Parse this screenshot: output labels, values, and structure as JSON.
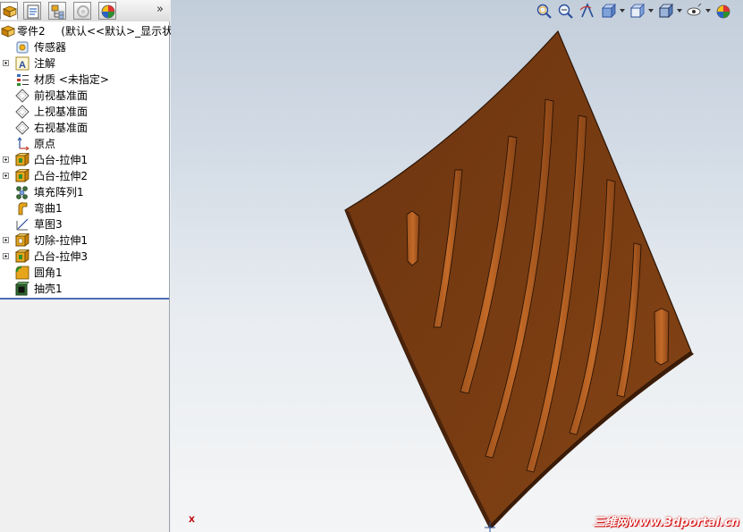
{
  "panel": {
    "tabs": [
      {
        "name": "featuremanager-tab",
        "icon": "feature-tree-icon",
        "active": true
      },
      {
        "name": "propertymanager-tab",
        "icon": "property-manager-icon",
        "active": false
      },
      {
        "name": "configurationmanager-tab",
        "icon": "configuration-manager-icon",
        "active": false
      },
      {
        "name": "dimxpert-tab",
        "icon": "dimxpert-icon",
        "active": false
      },
      {
        "name": "display-manager-tab",
        "icon": "display-manager-icon",
        "active": false
      }
    ],
    "expand_glyph": "»"
  },
  "tree": {
    "root": {
      "label": "零件2",
      "config": "(默认<<默认>_显示状态",
      "icon": "part-icon"
    },
    "items": [
      {
        "label": "传感器",
        "icon": "sensor-icon",
        "expandable": false
      },
      {
        "label": "注解",
        "icon": "annotation-icon",
        "expandable": true
      },
      {
        "label": "材质 <未指定>",
        "icon": "material-icon",
        "expandable": false
      },
      {
        "label": "前视基准面",
        "icon": "plane-icon",
        "expandable": false
      },
      {
        "label": "上视基准面",
        "icon": "plane-icon",
        "expandable": false
      },
      {
        "label": "右视基准面",
        "icon": "plane-icon",
        "expandable": false
      },
      {
        "label": "原点",
        "icon": "origin-icon",
        "expandable": false
      },
      {
        "label": "凸台-拉伸1",
        "icon": "extrude-icon",
        "expandable": true
      },
      {
        "label": "凸台-拉伸2",
        "icon": "extrude-icon",
        "expandable": true
      },
      {
        "label": "填充阵列1",
        "icon": "fill-pattern-icon",
        "expandable": false
      },
      {
        "label": "弯曲1",
        "icon": "flex-icon",
        "expandable": false
      },
      {
        "label": "草图3",
        "icon": "sketch-icon",
        "expandable": false
      },
      {
        "label": "切除-拉伸1",
        "icon": "cut-extrude-icon",
        "expandable": true
      },
      {
        "label": "凸台-拉伸3",
        "icon": "extrude-icon",
        "expandable": true
      },
      {
        "label": "圆角1",
        "icon": "fillet-icon",
        "expandable": false
      },
      {
        "label": "抽壳1",
        "icon": "shell-icon",
        "expandable": false
      }
    ]
  },
  "viewport": {
    "toolbar_icons": [
      "zoom-to-fit-icon",
      "zoom-to-area-icon",
      "previous-view-icon",
      "section-view-icon",
      "view-orientation-icon",
      "display-style-icon",
      "hide-show-items-icon"
    ],
    "watermark_cn": "三维网",
    "watermark_url": "www.3dportal.cn",
    "triad_label": "X",
    "colors": {
      "part_face": "#7a3d12",
      "part_edge": "#2b1405",
      "background_top": "#c3cedb",
      "background_bottom": "#f4f5f6"
    }
  }
}
